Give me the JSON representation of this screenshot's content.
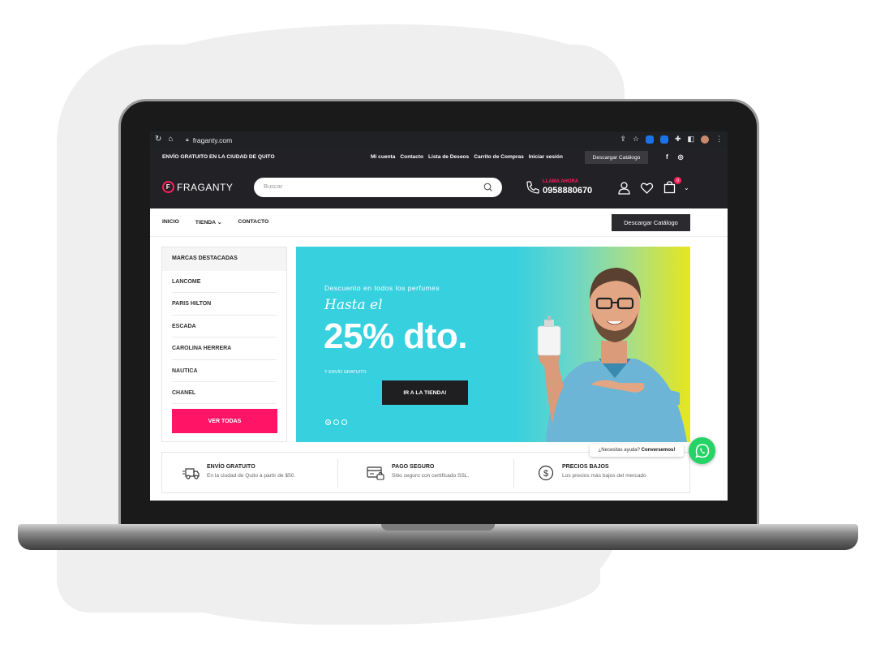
{
  "browser": {
    "url": "fraganty.com"
  },
  "topbar": {
    "shipping": "ENVÍO GRATUITO EN LA CIUDAD DE QUITO",
    "links": [
      "Mi cuenta",
      "Contacto",
      "Lista de Deseos",
      "Carrito de Compras",
      "Iniciar sesión"
    ],
    "download": "Descargar Catálogo",
    "social": [
      "f",
      "◎"
    ]
  },
  "header": {
    "logo_text": "FRAGANTY",
    "logo_mark": "F",
    "search_placeholder": "Buscar",
    "call_label": "LLAMA AHORA",
    "phone": "0958880670",
    "cart_count": "0"
  },
  "nav": {
    "items": [
      "INICIO",
      "TIENDA",
      "CONTACTO"
    ],
    "download_button": "Descargar Catálogo"
  },
  "sidebar": {
    "title": "MARCAS DESTACADAS",
    "brands": [
      "LANCOME",
      "PARIS HILTON",
      "ESCADA",
      "CAROLINA HERRERA",
      "NAUTICA",
      "CHANEL"
    ],
    "view_all": "VER TODAS"
  },
  "banner": {
    "subtitle": "Descuento en todos los perfumes",
    "script": "Hasta el",
    "headline": "25% dto.",
    "small": "Y ENVÍO GRATUITO",
    "cta": "IR A LA TIENDA!",
    "slides": 3,
    "active_slide": 1
  },
  "whatsapp": {
    "prompt": "¿Necesitas ayuda?",
    "prompt_bold": "Conversemos!"
  },
  "features": [
    {
      "title": "ENVÍO GRATUITO",
      "desc": "En la ciudad de Quito a partir de $50.",
      "icon": "truck-icon"
    },
    {
      "title": "PAGO SEGURO",
      "desc": "Sitio seguro con certificado SSL.",
      "icon": "secure-card-icon"
    },
    {
      "title": "PRECIOS BAJOS",
      "desc": "Los precios más bajos del mercado",
      "icon": "dollar-icon"
    }
  ],
  "colors": {
    "accent": "#ff1466",
    "dark": "#222226",
    "banner": "#36d0df",
    "whatsapp": "#25d366"
  }
}
